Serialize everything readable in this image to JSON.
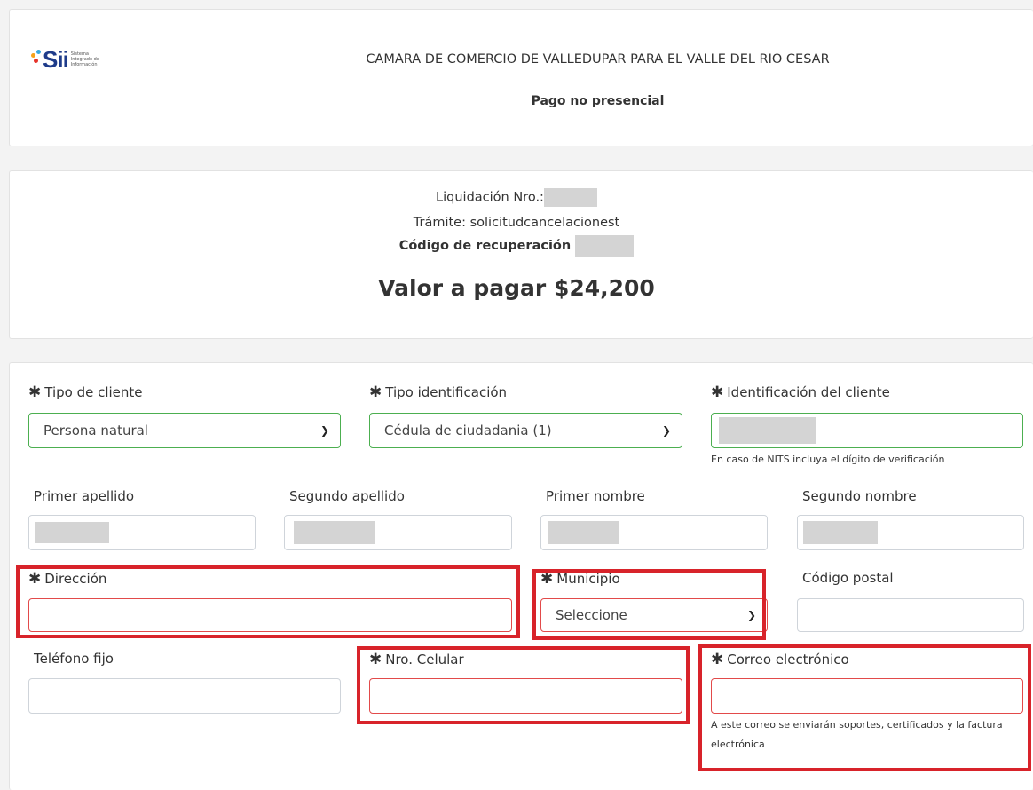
{
  "header": {
    "logo_text": "Sii",
    "logo_subtitle": [
      "Sistema",
      "Integrado de",
      "Información"
    ],
    "entity_name": "CAMARA DE COMERCIO DE VALLEDUPAR PARA EL VALLE DEL RIO CESAR",
    "page_subtitle": "Pago no presencial"
  },
  "summary": {
    "liquidacion_label": "Liquidación Nro.:",
    "tramite_label": "Trámite: solicitudcancelacionest",
    "codigo_label": "Código de recuperación",
    "total_label": "Valor a pagar $24,200"
  },
  "form": {
    "tipo_cliente": {
      "label": "Tipo de cliente",
      "value": "Persona natural",
      "required": true
    },
    "tipo_identificacion": {
      "label": "Tipo identificación",
      "value": "Cédula de ciudadania (1)",
      "required": true
    },
    "identificacion": {
      "label": "Identificación del cliente",
      "hint": "En caso de NITS incluya el dígito de verificación",
      "required": true
    },
    "primer_apellido": {
      "label": "Primer apellido"
    },
    "segundo_apellido": {
      "label": "Segundo apellido"
    },
    "primer_nombre": {
      "label": "Primer nombre"
    },
    "segundo_nombre": {
      "label": "Segundo nombre"
    },
    "direccion": {
      "label": "Dirección",
      "value": "",
      "required": true
    },
    "municipio": {
      "label": "Municipio",
      "value": "Seleccione",
      "required": true
    },
    "codigo_postal": {
      "label": "Código postal",
      "value": ""
    },
    "telefono_fijo": {
      "label": "Teléfono fijo",
      "value": ""
    },
    "celular": {
      "label": "Nro. Celular",
      "value": "",
      "required": true
    },
    "correo": {
      "label": "Correo electrónico",
      "value": "",
      "hint": "A este correo se enviarán soportes, certificados y la factura electrónica",
      "required": true
    }
  },
  "required_marker": "✱",
  "colors": {
    "highlight": "#d8232a",
    "valid_border": "#4caf50",
    "invalid_border": "#e24a4a",
    "logo_blue": "#1e3b8a"
  }
}
